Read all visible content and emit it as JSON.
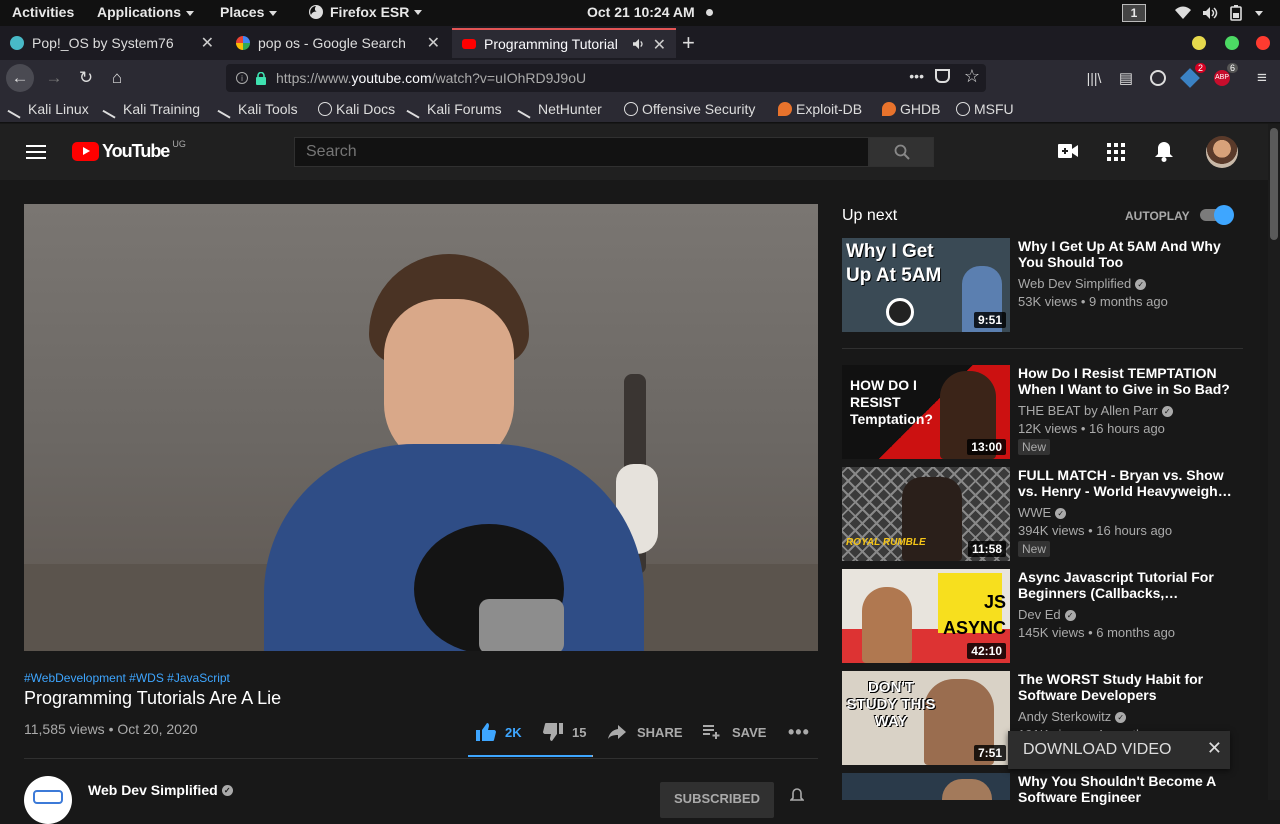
{
  "system_bar": {
    "activities": "Activities",
    "applications": "Applications",
    "places": "Places",
    "app": "Firefox ESR",
    "clock": "Oct 21  10:24 AM",
    "workspace": "1"
  },
  "tabs": [
    {
      "label": "Pop!_OS by System76"
    },
    {
      "label": "pop os - Google Search"
    },
    {
      "label": "Programming Tutorial"
    }
  ],
  "url": {
    "prefix": "https://www.",
    "domain": "youtube.com",
    "path": "/watch?v=uIOhRD9J9oU"
  },
  "extensions": {
    "badge1": "2",
    "badge2": "6"
  },
  "bookmarks": [
    {
      "label": "Kali Linux",
      "icon": "kali-dragon-icon"
    },
    {
      "label": "Kali Training",
      "icon": "kali-dragon-icon"
    },
    {
      "label": "Kali Tools",
      "icon": "kali-dragon-icon"
    },
    {
      "label": "Kali Docs",
      "icon": "globe-icon"
    },
    {
      "label": "Kali Forums",
      "icon": "kali-dragon-icon"
    },
    {
      "label": "NetHunter",
      "icon": "kali-dragon-icon"
    },
    {
      "label": "Offensive Security",
      "icon": "globe-icon"
    },
    {
      "label": "Exploit-DB",
      "icon": "exploit-db-icon"
    },
    {
      "label": "GHDB",
      "icon": "exploit-db-icon"
    },
    {
      "label": "MSFU",
      "icon": "globe-icon"
    }
  ],
  "youtube": {
    "logo_text": "YouTube",
    "country": "UG",
    "search_placeholder": "Search",
    "accent": "#3ea6ff",
    "brand_red": "#ff0000"
  },
  "video": {
    "hashtags": "#WebDevelopment #WDS #JavaScript",
    "title": "Programming Tutorials Are A Lie",
    "views_date": "11,585 views • Oct 20, 2020",
    "likes": "2K",
    "dislikes": "15",
    "share": "SHARE",
    "save": "SAVE",
    "like_ratio": 0.99
  },
  "channel": {
    "name": "Web Dev Simplified",
    "subscribe_label": "SUBSCRIBED"
  },
  "sidebar": {
    "up_next": "Up next",
    "autoplay": "AUTOPLAY",
    "autoplay_on": true,
    "items": [
      {
        "title": "Why I Get Up At 5AM And Why You Should Too",
        "channel": "Web Dev Simplified",
        "meta": "53K views • 9 months ago",
        "duration": "9:51",
        "badge": "",
        "thumb_text": "Why I Get Up At 5AM"
      },
      {
        "title": "How Do I Resist TEMPTATION When I Want to Give in So Bad?",
        "channel": "THE BEAT by Allen Parr",
        "meta": "12K views • 16 hours ago",
        "duration": "13:00",
        "badge": "New",
        "thumb_text": "HOW DO I RESIST Temptation?"
      },
      {
        "title": "FULL MATCH - Bryan vs. Show vs. Henry - World Heavyweigh…",
        "channel": "WWE",
        "meta": "394K views • 16 hours ago",
        "duration": "11:58",
        "badge": "New",
        "thumb_text": "ROYAL RUMBLE"
      },
      {
        "title": "Async Javascript Tutorial For Beginners (Callbacks,…",
        "channel": "Dev Ed",
        "meta": "145K views • 6 months ago",
        "duration": "42:10",
        "badge": "",
        "thumb_text": "JS ASYNC"
      },
      {
        "title": "The WORST Study Habit for Software Developers",
        "channel": "Andy Sterkowitz",
        "meta": "191K views • 4 months ago",
        "duration": "7:51",
        "badge": "",
        "thumb_text": "DON'T STUDY THIS WAY"
      },
      {
        "title": "Why You Shouldn't Become A Software Engineer",
        "channel": "",
        "meta": "",
        "duration": "",
        "badge": "",
        "thumb_text": ""
      }
    ]
  },
  "download_popup": {
    "label": "DOWNLOAD VIDEO"
  }
}
